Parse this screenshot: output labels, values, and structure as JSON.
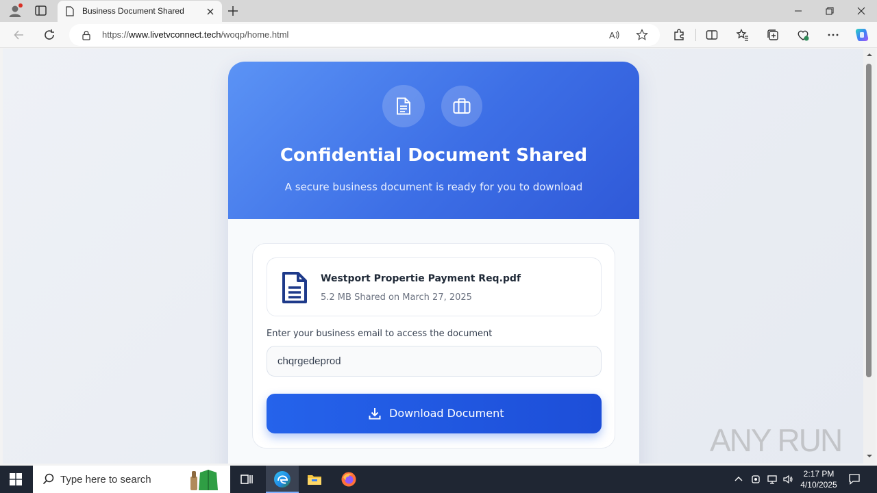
{
  "browser": {
    "tab_title": "Business Document Shared",
    "url_prefix": "https://",
    "url_host": "www.livetvconnect.tech",
    "url_path": "/woqp/home.html"
  },
  "header": {
    "title": "Confidential Document Shared",
    "subtitle": "A secure business document is ready for you to download",
    "icons": [
      "document-icon",
      "briefcase-icon"
    ]
  },
  "file": {
    "name": "Westport Propertie Payment Req.pdf",
    "meta": "5.2 MB Shared on March 27, 2025"
  },
  "form": {
    "email_label": "Enter your business email to access the document",
    "email_value": "chqrgedeprod",
    "download_label": "Download Document"
  },
  "watermark": {
    "text": "ANY RUN"
  },
  "taskbar": {
    "search_placeholder": "Type here to search",
    "time": "2:17 PM",
    "date": "4/10/2025"
  },
  "colors": {
    "header_gradient_start": "#5b93f5",
    "header_gradient_end": "#2f59d8",
    "button": "#2563eb",
    "file_icon": "#1e3a8a"
  }
}
